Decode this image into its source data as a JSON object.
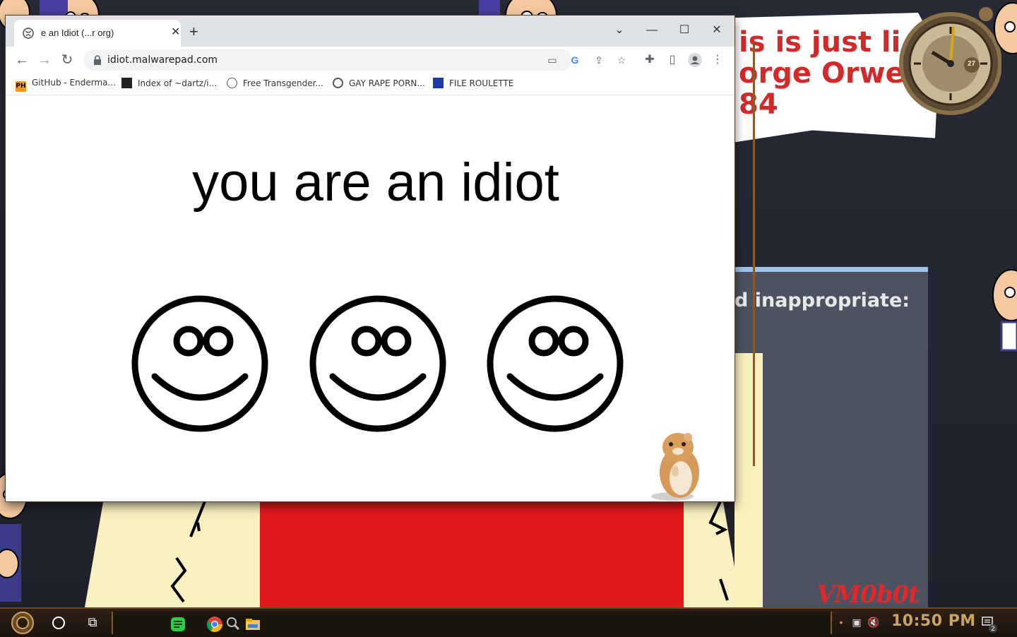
{
  "desktop": {
    "headline_lines": [
      "is is just li",
      "orge Orwe",
      "84"
    ],
    "panel_text": "d inappropriate:",
    "signature": "VM0b0t",
    "clock_day": "27"
  },
  "browser": {
    "tab": {
      "title": "e an Idiot (...r org)"
    },
    "window_controls": {
      "minimize": "—",
      "maximize": "☐",
      "close": "✕"
    },
    "url": "idiot.malwarepad.com",
    "bookmarks": [
      {
        "label": "GitHub - Enderma...",
        "icon": "PH"
      },
      {
        "label": "Index of ~dartz/i...",
        "icon": "qr"
      },
      {
        "label": "Free Transgender...",
        "icon": "globe"
      },
      {
        "label": "GAY RAPE PORN...",
        "icon": "globe"
      },
      {
        "label": "FILE ROULETTE",
        "icon": "file"
      }
    ],
    "page": {
      "headline": "you are an idiot",
      "smiley_count": 3
    }
  },
  "taskbar": {
    "time": "10:50 PM",
    "notification_count": "2"
  },
  "colors": {
    "accent_red": "#e31a1c",
    "clock_gold": "#c9a366",
    "tabstrip": "#dee1e6"
  }
}
